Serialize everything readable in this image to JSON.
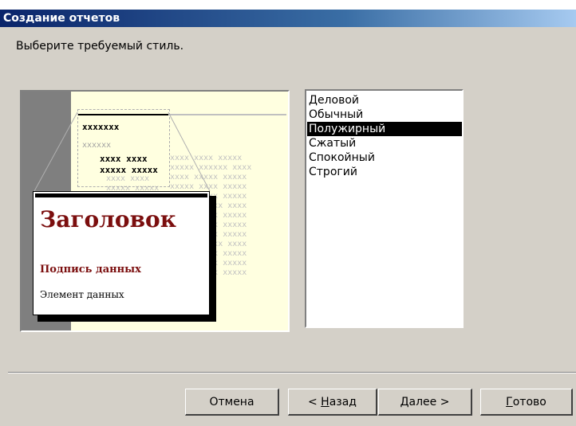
{
  "window": {
    "title": "Создание отчетов"
  },
  "prompt": "Выберите требуемый стиль.",
  "preview": {
    "heading_text": "Заголовок",
    "label_text": "Подпись данных",
    "item_text": "Элемент данных",
    "placeholder_bold_1": "xxxxxxx",
    "placeholder_light_1": "xxxxxx",
    "placeholder_bold_2": "xxxx xxxx",
    "placeholder_bold_3": "xxxxx xxxxx"
  },
  "styles": {
    "items": [
      "Деловой",
      "Обычный",
      "Полужирный",
      "Сжатый",
      "Спокойный",
      "Строгий"
    ],
    "selected_index": 2
  },
  "buttons": {
    "cancel": "Отмена",
    "back": "< Назад",
    "back_mnemonic": "Н",
    "next": "Далее >",
    "next_mnemonic": "Д",
    "finish": "Готово",
    "finish_mnemonic": "Г"
  }
}
